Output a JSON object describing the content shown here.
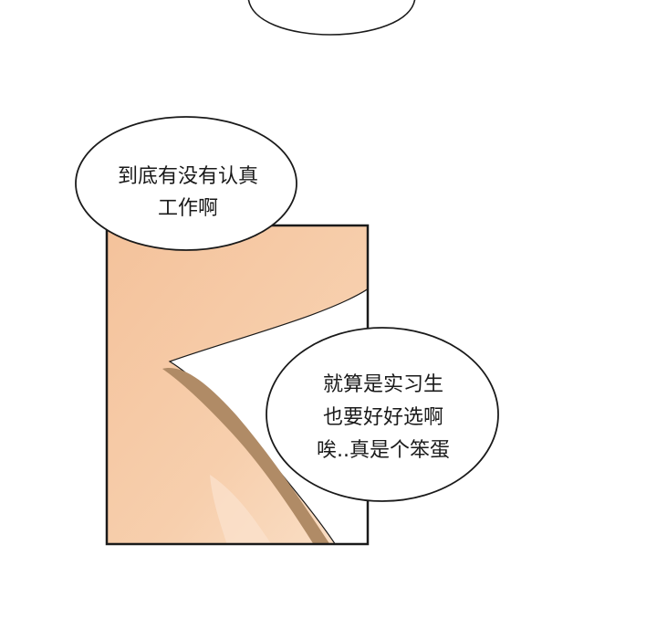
{
  "bubbles": {
    "top_partial": {
      "lines": []
    },
    "upper": {
      "lines": [
        "到底有没有认真",
        "工作啊"
      ]
    },
    "lower": {
      "lines": [
        "就算是实习生",
        "也要好好选啊",
        "唉..真是个笨蛋"
      ]
    }
  },
  "colors": {
    "background": "#ffffff",
    "skin": "#f6c8a2",
    "skin_highlight": "#f9dcc4",
    "shadow": "#b5916c",
    "outline": "#1a1a1a",
    "bubble_fill": "#ffffff"
  }
}
